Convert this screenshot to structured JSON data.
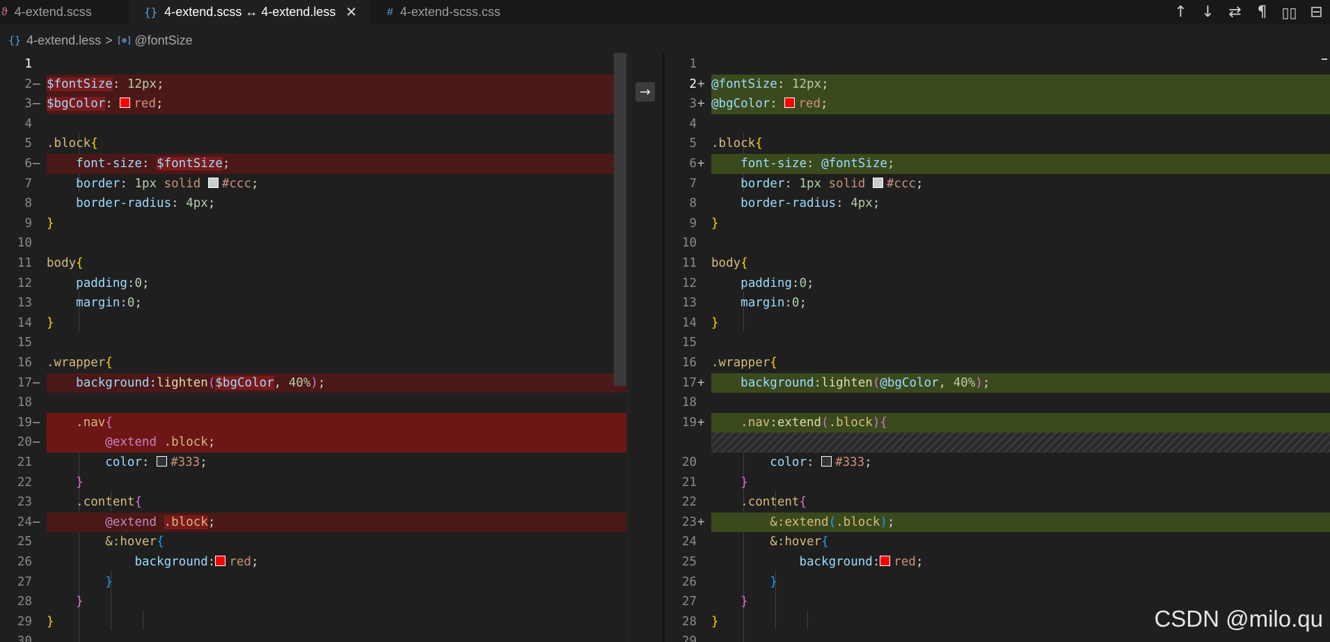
{
  "tabs": [
    {
      "label": "4-extend.scss",
      "icon": "sass-icon",
      "active": false
    },
    {
      "label": "4-extend.scss ↔ 4-extend.less",
      "icon": "braces-icon",
      "active": true
    },
    {
      "label": "4-extend-scss.css",
      "icon": "hash-icon",
      "active": false
    }
  ],
  "tab_close": "✕",
  "actions": [
    {
      "name": "previous-change-button",
      "glyph": "↑"
    },
    {
      "name": "next-change-button",
      "glyph": "↓"
    },
    {
      "name": "swap-sides-button",
      "glyph": "⇄"
    },
    {
      "name": "show-whitespace-button",
      "glyph": "¶"
    },
    {
      "name": "open-file-button",
      "glyph": "🕮"
    },
    {
      "name": "split-editor-button",
      "glyph": "⊟"
    }
  ],
  "breadcrumb": {
    "icon": "{}",
    "file": "4-extend.less",
    "separator": ">",
    "symbol_icon": "[⊕]",
    "symbol": "@fontSize"
  },
  "revert_arrow": "→",
  "left_lines": [
    {
      "n": "1"
    },
    {
      "n": "2",
      "mark": "—"
    },
    {
      "n": "3",
      "mark": "—"
    },
    {
      "n": "4"
    },
    {
      "n": "5"
    },
    {
      "n": "6",
      "mark": "—"
    },
    {
      "n": "7"
    },
    {
      "n": "8"
    },
    {
      "n": "9"
    },
    {
      "n": "10"
    },
    {
      "n": "11"
    },
    {
      "n": "12"
    },
    {
      "n": "13"
    },
    {
      "n": "14"
    },
    {
      "n": "15"
    },
    {
      "n": "16"
    },
    {
      "n": "17",
      "mark": "—"
    },
    {
      "n": "18"
    },
    {
      "n": "19",
      "mark": "—"
    },
    {
      "n": "20",
      "mark": "—"
    },
    {
      "n": "21"
    },
    {
      "n": "22"
    },
    {
      "n": "23"
    },
    {
      "n": "24",
      "mark": "—"
    },
    {
      "n": "25"
    },
    {
      "n": "26"
    },
    {
      "n": "27"
    },
    {
      "n": "28"
    },
    {
      "n": "29"
    },
    {
      "n": "30"
    }
  ],
  "right_lines": [
    {
      "n": "1"
    },
    {
      "n": "2",
      "mark": "+"
    },
    {
      "n": "3",
      "mark": "+"
    },
    {
      "n": "4"
    },
    {
      "n": "5"
    },
    {
      "n": "6",
      "mark": "+"
    },
    {
      "n": "7"
    },
    {
      "n": "8"
    },
    {
      "n": "9"
    },
    {
      "n": "10"
    },
    {
      "n": "11"
    },
    {
      "n": "12"
    },
    {
      "n": "13"
    },
    {
      "n": "14"
    },
    {
      "n": "15"
    },
    {
      "n": "16"
    },
    {
      "n": "17",
      "mark": "+"
    },
    {
      "n": "18"
    },
    {
      "n": "19",
      "mark": "+"
    },
    {
      "n": ""
    },
    {
      "n": "20"
    },
    {
      "n": "21"
    },
    {
      "n": "22"
    },
    {
      "n": "23",
      "mark": "+"
    },
    {
      "n": "24"
    },
    {
      "n": "25"
    },
    {
      "n": "26"
    },
    {
      "n": "27"
    },
    {
      "n": "28"
    },
    {
      "n": "29"
    }
  ],
  "left_code": {
    "l2_var": "$fontSize",
    "l2_colon": ":",
    "l2_val": "12px",
    "semi": ";",
    "l3_var": "$bgColor",
    "l3_val": "red",
    "block_sel": ".block",
    "open": "{",
    "close": "}",
    "l6_prop": "font-size",
    "l6_val": "$fontSize",
    "l7_prop": "border",
    "l7_num": "1px",
    "l7_kw": "solid",
    "l7_col": "#ccc",
    "l8_prop": "border-radius",
    "l8_val": "4px",
    "body_sel": "body",
    "padding_prop": "padding",
    "margin_prop": "margin",
    "zero": "0",
    "wrapper_sel": ".wrapper",
    "l17_prop": "background",
    "l17_fn": "lighten",
    "l17_arg": "$bgColor",
    "l17_pct": "40%",
    "nav_sel": ".nav",
    "extend_at": "@extend",
    "extend_target": ".block",
    "color_prop": "color",
    "color_val": "#333",
    "content_sel": ".content",
    "hover_sel": "&:hover",
    "bg_prop": "background",
    "bg_val": "red"
  },
  "right_code": {
    "l2_var": "@fontSize",
    "l2_val": "12px",
    "l3_var": "@bgColor",
    "l3_val": "red",
    "l6_val": "@fontSize",
    "l17_arg": "@bgColor",
    "nav_extend": ":extend",
    "amp_extend": "&:extend"
  },
  "colors": {
    "deleted_bg": "#4b1818",
    "inserted_bg": "#3b4a1c",
    "swatch_red": "#ff0000",
    "swatch_ccc": "#cccccc",
    "swatch_333": "#333333"
  },
  "watermark": "CSDN @milo.qu"
}
